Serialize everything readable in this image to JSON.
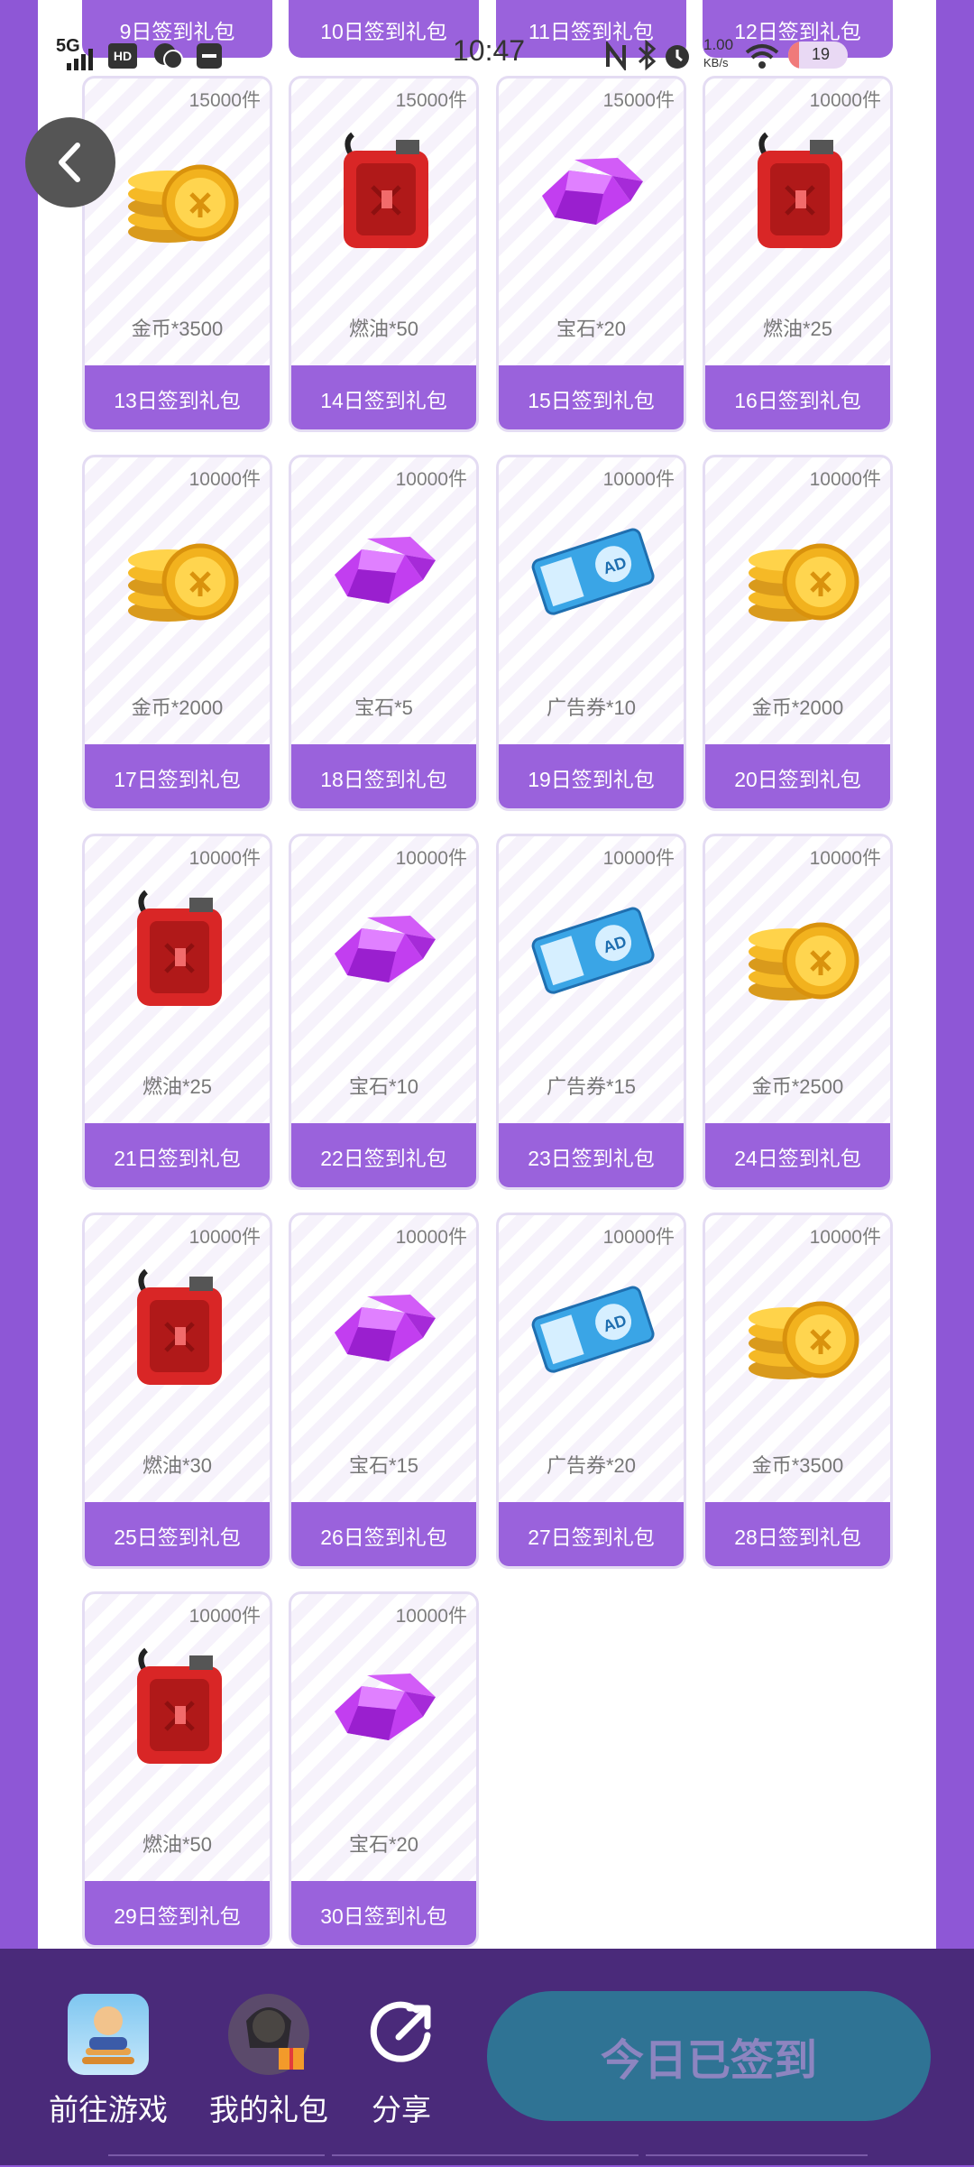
{
  "status_bar": {
    "time": "10:47",
    "network": "5G",
    "hd": "HD",
    "speed": "1.00",
    "speed_unit": "KB/s",
    "battery": "19"
  },
  "top_partial_cards": [
    {
      "label": "9日签到礼包"
    },
    {
      "label": "10日签到礼包"
    },
    {
      "label": "11日签到礼包"
    },
    {
      "label": "12日签到礼包"
    }
  ],
  "rows": [
    [
      {
        "count": "15000件",
        "item": "金币*3500",
        "label": "13日签到礼包",
        "icon": "coin-icon"
      },
      {
        "count": "15000件",
        "item": "燃油*50",
        "label": "14日签到礼包",
        "icon": "fuel-can-icon"
      },
      {
        "count": "15000件",
        "item": "宝石*20",
        "label": "15日签到礼包",
        "icon": "gem-icon"
      },
      {
        "count": "10000件",
        "item": "燃油*25",
        "label": "16日签到礼包",
        "icon": "fuel-can-icon"
      }
    ],
    [
      {
        "count": "10000件",
        "item": "金币*2000",
        "label": "17日签到礼包",
        "icon": "coin-icon"
      },
      {
        "count": "10000件",
        "item": "宝石*5",
        "label": "18日签到礼包",
        "icon": "gem-icon"
      },
      {
        "count": "10000件",
        "item": "广告券*10",
        "label": "19日签到礼包",
        "icon": "ad-ticket-icon"
      },
      {
        "count": "10000件",
        "item": "金币*2000",
        "label": "20日签到礼包",
        "icon": "coin-icon"
      }
    ],
    [
      {
        "count": "10000件",
        "item": "燃油*25",
        "label": "21日签到礼包",
        "icon": "fuel-can-icon"
      },
      {
        "count": "10000件",
        "item": "宝石*10",
        "label": "22日签到礼包",
        "icon": "gem-icon"
      },
      {
        "count": "10000件",
        "item": "广告券*15",
        "label": "23日签到礼包",
        "icon": "ad-ticket-icon"
      },
      {
        "count": "10000件",
        "item": "金币*2500",
        "label": "24日签到礼包",
        "icon": "coin-icon"
      }
    ],
    [
      {
        "count": "10000件",
        "item": "燃油*30",
        "label": "25日签到礼包",
        "icon": "fuel-can-icon"
      },
      {
        "count": "10000件",
        "item": "宝石*15",
        "label": "26日签到礼包",
        "icon": "gem-icon"
      },
      {
        "count": "10000件",
        "item": "广告券*20",
        "label": "27日签到礼包",
        "icon": "ad-ticket-icon"
      },
      {
        "count": "10000件",
        "item": "金币*3500",
        "label": "28日签到礼包",
        "icon": "coin-icon"
      }
    ],
    [
      {
        "count": "10000件",
        "item": "燃油*50",
        "label": "29日签到礼包",
        "icon": "fuel-can-icon"
      },
      {
        "count": "10000件",
        "item": "宝石*20",
        "label": "30日签到礼包",
        "icon": "gem-icon"
      }
    ]
  ],
  "bottom_nav": {
    "go_game": "前往游戏",
    "my_gifts": "我的礼包",
    "share": "分享",
    "signed_button": "今日已签到"
  },
  "ad_ticket_text": "AD",
  "colors": {
    "background": "#8e57d6",
    "button": "#9a62dc",
    "bottom_bar": "#4a2a7a",
    "signed_button": "#2f7394"
  }
}
